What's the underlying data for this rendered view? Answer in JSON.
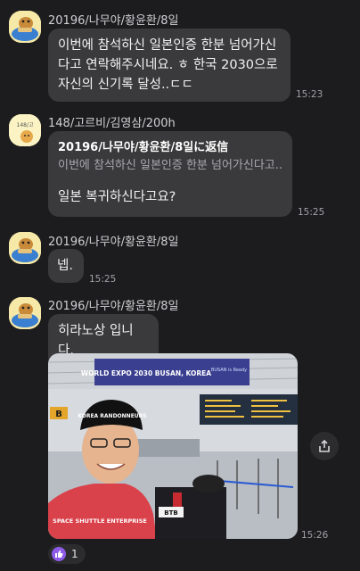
{
  "messages": [
    {
      "sender": "20196/나무야/황윤환/8일",
      "lines": [
        "이번에 참석하신 일본인증 한분 넘어가신",
        "다고 연락해주시네요. ㅎ 한국 2030으로",
        "자신의 신기록 달성..ㄷㄷ"
      ],
      "time": "15:23"
    },
    {
      "sender": "148/고르비/김영삼/200h",
      "avatar_label": "148/고",
      "reply_to": "20196/나무야/황윤환/8일に返信",
      "reply_quote": "이번에 참석하신 일본인증 한분 넘어가신다고...",
      "text": "일본 복귀하신다고요?",
      "time": "15:25"
    },
    {
      "sender": "20196/나무야/황윤환/8일",
      "text": "넵.",
      "time": "15:25"
    },
    {
      "sender": "20196/나무야/황윤환/8일",
      "text": "히라노상 입니다.",
      "time": "15:26",
      "photo": {
        "banner": "WORLD EXPO 2030 BUSAN, KOREA",
        "banner_sub": "BUSAN is Ready",
        "cap_text": "KOREA RANDONNEURS",
        "shirt_text": "SPACE SHUTTLE ENTERPRISE",
        "sign": "B",
        "box_label": "BTB"
      }
    }
  ],
  "reaction": {
    "icon": "thumbs-up-icon",
    "count": "1",
    "color": "#8e5be8"
  },
  "share": {
    "icon": "share-icon"
  },
  "colors": {
    "background": "#1c1c1e",
    "bubble": "#3a3a3c"
  }
}
